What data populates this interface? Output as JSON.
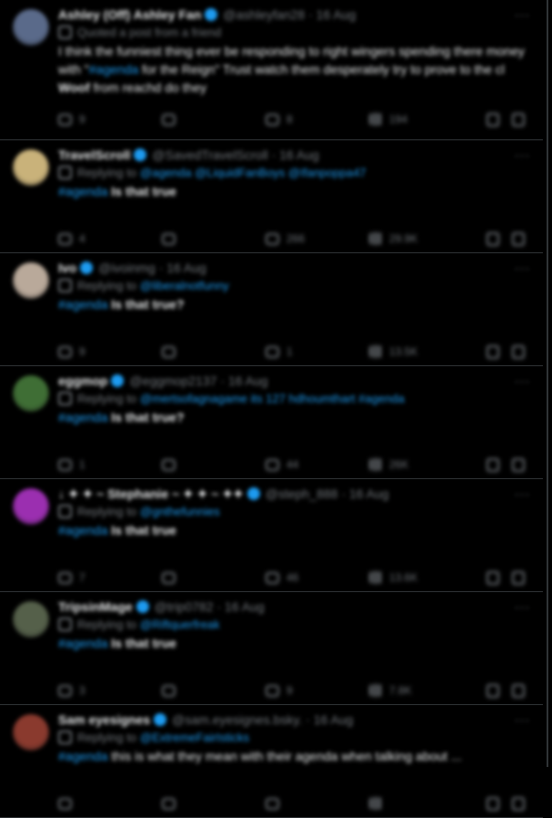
{
  "tweets": [
    {
      "name": "Ashley (Off) Ashley Fan",
      "handle": "@ashleyfan28",
      "time": "· 16 Aug",
      "sub_text": "Quoted a post from a friend",
      "sub_link": "",
      "body_pre": "I think the funniest thing ever be responding to right wingers spending there money with \"",
      "hashtag": "#agenda",
      "body_mid": " for the Reign\" Trust watch them desperately try to prove to the cl ",
      "bold": "Woof",
      "body_post": " from reachd do they",
      "reply": "9",
      "repost": "",
      "like": "8",
      "views": "194",
      "avatar_color": "#5a6a8a"
    },
    {
      "name": "TravelScroll",
      "handle": "@SavedTravelScroll",
      "time": "· 16 Aug",
      "sub_text": "Replying to",
      "sub_link": "@agenda @LiquidFanBoys @Ifanpoppa47",
      "body_pre": "",
      "hashtag": "#agenda",
      "body_mid": " ",
      "bold": "Is that true",
      "body_post": "",
      "reply": "4",
      "repost": "",
      "like": "266",
      "views": "29.9K",
      "avatar_color": "#c9b27a"
    },
    {
      "name": "Ivo",
      "handle": "@ivoinmg",
      "time": "· 16 Aug",
      "sub_text": "Replying to",
      "sub_link": "@liberalnotfunny",
      "body_pre": "",
      "hashtag": "#agenda",
      "body_mid": " ",
      "bold": "Is that true?",
      "body_post": "",
      "reply": "9",
      "repost": "",
      "like": "1",
      "views": "13.5K",
      "avatar_color": "#b9a99a"
    },
    {
      "name": "eggmop",
      "handle": "@eggmop2137",
      "time": "· 16 Aug",
      "sub_text": "Replying to",
      "sub_link": "@mertsofagnagame its 127 hdhoumthart #agenda",
      "body_pre": "",
      "hashtag": "#agenda",
      "body_mid": " ",
      "bold": "Is that true?",
      "body_post": "",
      "reply": "1",
      "repost": "",
      "like": "44",
      "views": "26K",
      "avatar_color": "#3f6e35"
    },
    {
      "name": "↓ ✦ ✦ ~ Stephanie ~ ✦ ✦ ~ ✦✦",
      "handle": "@steph_888",
      "time": "· 16 Aug",
      "sub_text": "Replying to",
      "sub_link": "@gnthefunnies",
      "body_pre": "",
      "hashtag": "#agenda",
      "body_mid": " ",
      "bold": "Is that true",
      "body_post": "",
      "reply": "7",
      "repost": "",
      "like": "46",
      "views": "13.6K",
      "avatar_color": "#9b2fb0"
    },
    {
      "name": "TripsinMage",
      "handle": "@trip0782",
      "time": "· 16 Aug",
      "sub_text": "Replying to",
      "sub_link": "@Riftquerfreak",
      "body_pre": "",
      "hashtag": "#agenda",
      "body_mid": " ",
      "bold": "Is that true",
      "body_post": "",
      "reply": "3",
      "repost": "",
      "like": "9",
      "views": "7.8K",
      "avatar_color": "#55604a"
    },
    {
      "name": "Sam eyesignes",
      "handle": "@sam.eyesignes.bsky.",
      "time": "· 16 Aug",
      "sub_text": "Replying to",
      "sub_link": "@ExtremeFairIsticks",
      "body_pre": "",
      "hashtag": "#agenda",
      "body_mid": " this is what they mean with their agenda when talking about ...",
      "bold": "",
      "body_post": "",
      "reply": "",
      "repost": "",
      "like": "",
      "views": "",
      "avatar_color": "#8a3a2e"
    }
  ],
  "more_label": "···"
}
